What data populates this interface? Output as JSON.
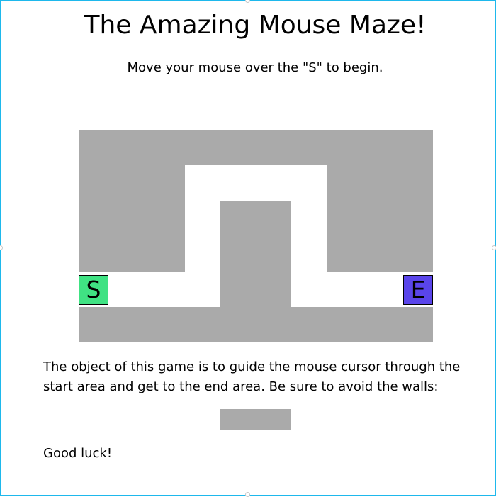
{
  "page": {
    "title": "The Amazing Mouse Maze!",
    "instructions": "Move your mouse over the \"S\" to begin.",
    "description": "The object of this game is to guide the mouse cursor through the start area and get to the end area. Be sure to avoid the walls:",
    "closing": "Good luck!"
  },
  "maze": {
    "start_label": "S",
    "end_label": "E",
    "colors": {
      "wall": "#aaaaaa",
      "start": "#40e283",
      "end": "#5a45ea",
      "background": "#ffffff",
      "frame": "#1eb8ec"
    }
  }
}
